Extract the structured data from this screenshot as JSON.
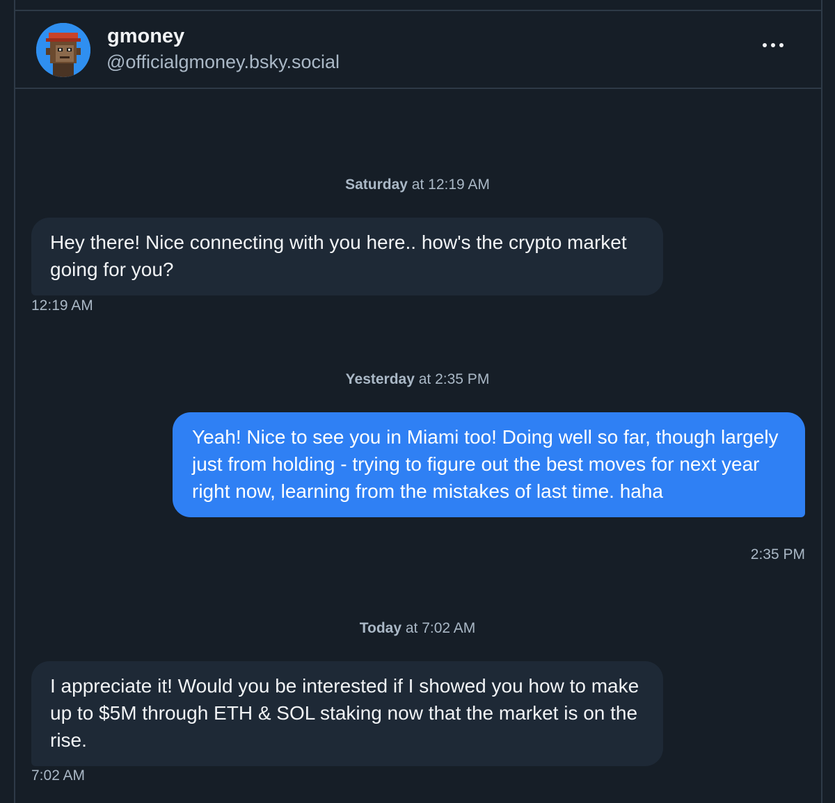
{
  "conversation": {
    "name": "gmoney",
    "handle": "@officialgmoney.bsky.social"
  },
  "colors": {
    "background": "#161e27",
    "incoming_bubble": "#1e2936",
    "outgoing_bubble": "#2f80f4",
    "avatar_bg": "#2f8ff0"
  },
  "icons": {
    "avatar": "pixel-ape-avatar",
    "more": "more-options-icon"
  },
  "messages": [
    {
      "date_day": "Saturday",
      "date_time": " at 12:19 AM",
      "direction": "incoming",
      "text": "Hey there! Nice connecting with you here.. how's the crypto market going for you?",
      "time": "12:19 AM"
    },
    {
      "date_day": "Yesterday",
      "date_time": " at 2:35 PM",
      "direction": "outgoing",
      "text": "Yeah! Nice to see you in Miami too! Doing well so far, though largely just from holding - trying to figure out the best moves for next year right now, learning from the mistakes of last time. haha",
      "time": "2:35 PM"
    },
    {
      "date_day": "Today",
      "date_time": " at 7:02 AM",
      "direction": "incoming",
      "text": "I appreciate it! Would you be interested if I showed you how to make up to $5M through ETH & SOL staking now that the market is on the rise.",
      "time": "7:02 AM"
    }
  ]
}
